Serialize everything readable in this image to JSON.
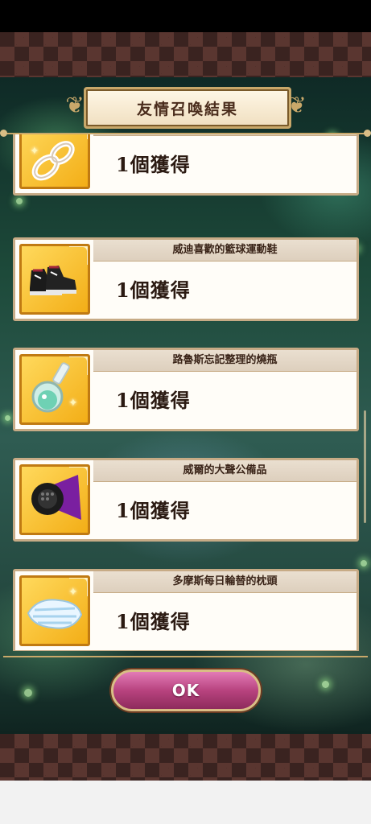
{
  "dialog": {
    "title": "友情召喚結果",
    "ok_label": "OK"
  },
  "items": [
    {
      "name": "",
      "quantity": "1個獲得",
      "icon": "rope-icon"
    },
    {
      "name": "威迪喜歡的籃球運動鞋",
      "quantity": "1個獲得",
      "icon": "sneakers-icon"
    },
    {
      "name": "路魯斯忘記整理的燒瓶",
      "quantity": "1個獲得",
      "icon": "flask-icon"
    },
    {
      "name": "威爾的大聲公備品",
      "quantity": "1個獲得",
      "icon": "megaphone-icon"
    },
    {
      "name": "多摩斯每日輪替的枕頭",
      "quantity": "1個獲得",
      "icon": "pillow-icon"
    }
  ],
  "colors": {
    "accent_gold": "#c9a86a",
    "item_frame": "#f3ae17",
    "ok_button": "#b8437f"
  }
}
